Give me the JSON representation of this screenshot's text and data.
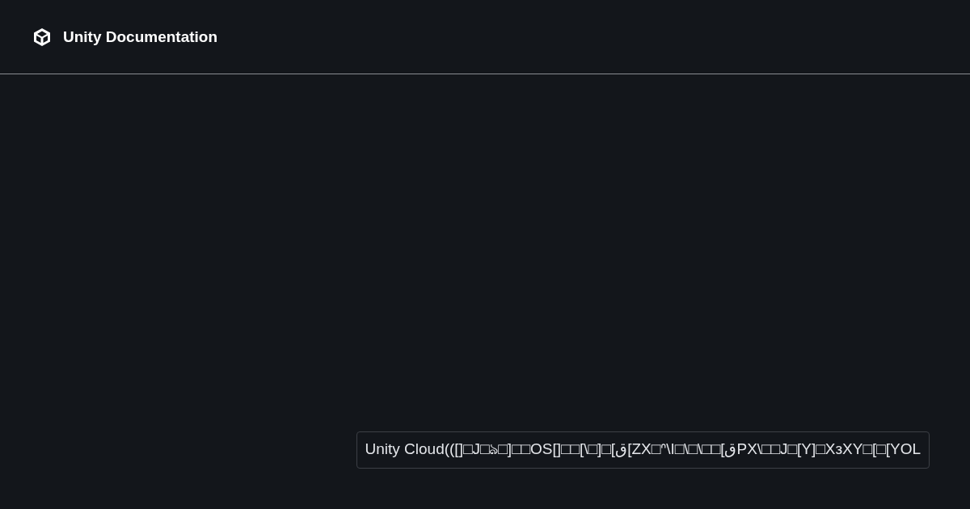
{
  "header": {
    "title": "Unity Documentation"
  },
  "tooltip": {
    "text": "Unity Cloud(([]□J□ঌ□]□□OS[]□□[\\□]□[ق[ZX□ᐢ\\I□\\□\\□□[قPX\\□□J□[Y]□XзXY□[□[YOL"
  }
}
